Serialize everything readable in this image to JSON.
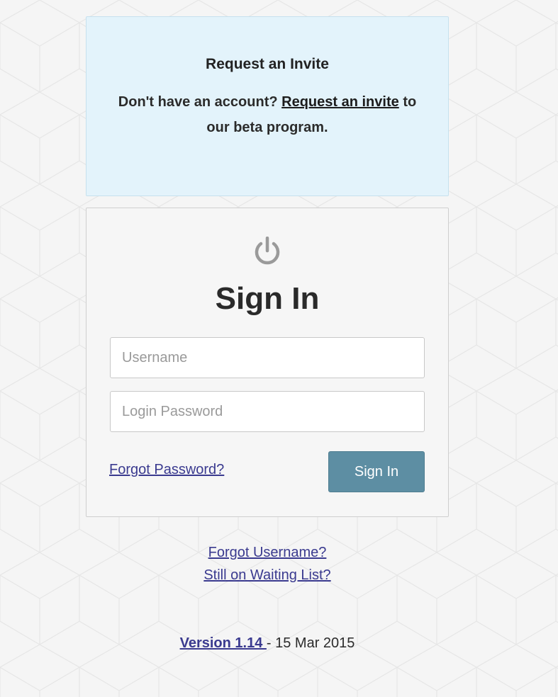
{
  "invite": {
    "title": "Request an Invite",
    "text_prefix": "Don't have an account?",
    "link_label": "Request an invite",
    "text_suffix": "to our beta program."
  },
  "signin": {
    "icon": "power-icon",
    "title": "Sign In",
    "username_placeholder": "Username",
    "password_placeholder": "Login Password",
    "forgot_password_label": "Forgot Password?",
    "submit_label": "Sign In"
  },
  "links": {
    "forgot_username": "Forgot Username?",
    "waiting_list": "Still on Waiting List?"
  },
  "footer": {
    "version_label": "Version 1.14 ",
    "date_text": "- 15 Mar 2015"
  },
  "colors": {
    "invite_bg": "#e3f3fb",
    "card_bg": "#f6f6f6",
    "button_bg": "#5d8ea3",
    "link": "#3a3a8f"
  }
}
